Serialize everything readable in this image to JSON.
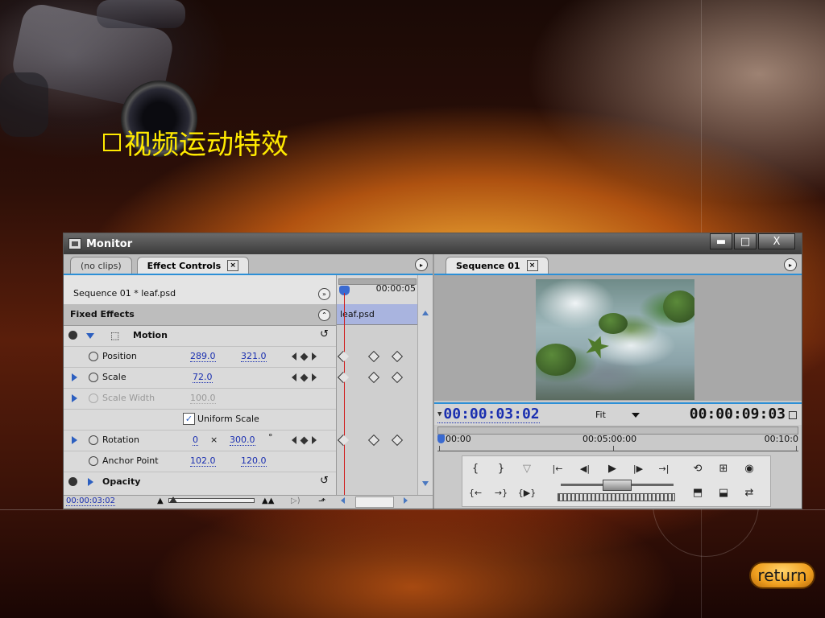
{
  "slide": {
    "title": "视频运动特效",
    "return_label": "return"
  },
  "window": {
    "title": "Monitor",
    "controls": {
      "minimize": "▬",
      "maximize": "□",
      "close": "X"
    }
  },
  "effect_controls": {
    "tabs": [
      {
        "label": "(no clips)"
      },
      {
        "label": "Effect Controls",
        "close": "×"
      }
    ],
    "sequence_label": "Sequence 01 * leaf.psd",
    "fixed_effects_label": "Fixed Effects",
    "motion": {
      "label": "Motion",
      "properties": {
        "position": {
          "label": "Position",
          "x": "289.0",
          "y": "321.0"
        },
        "scale": {
          "label": "Scale",
          "value": "72.0"
        },
        "scale_width": {
          "label": "Scale Width",
          "value": "100.0"
        },
        "uniform_scale": {
          "label": "Uniform Scale",
          "checked": true
        },
        "rotation": {
          "label": "Rotation",
          "turns": "0",
          "times": "×",
          "degrees": "300.0",
          "degree_symbol": "°"
        },
        "anchor_point": {
          "label": "Anchor Point",
          "x": "102.0",
          "y": "120.0"
        }
      }
    },
    "opacity": {
      "label": "Opacity"
    },
    "timeline": {
      "timecode": "00:00:05",
      "clip_name": "leaf.psd"
    },
    "current_timecode": "00:00:03:02"
  },
  "program": {
    "tab": {
      "label": "Sequence 01",
      "close": "×"
    },
    "current_timecode": "00:00:03:02",
    "fit_label": "Fit",
    "duration_timecode": "00:00:09:03",
    "ruler_labels": [
      "00:00",
      "00:05:00:00",
      "00:10:0"
    ],
    "controls": {
      "mark_in": "{",
      "mark_out": "}",
      "set_marker": "▽",
      "go_to_in": "|←",
      "step_back": "◀|",
      "play": "▶",
      "step_forward": "|▶",
      "go_to_out": "→|",
      "go_to_prev_edit": "{←",
      "go_to_next_edit": "→}",
      "play_in_to_out": "{▶}",
      "loop": "⟲",
      "safe_margins": "⊞",
      "output": "◉",
      "lift": "⬒",
      "extract": "⬓",
      "trim": "⇄"
    }
  },
  "colors": {
    "title_yellow": "#ffea00",
    "accent_blue": "#2c8fd6",
    "value_blue": "#1a2fb0",
    "cti_red": "#d02020"
  }
}
